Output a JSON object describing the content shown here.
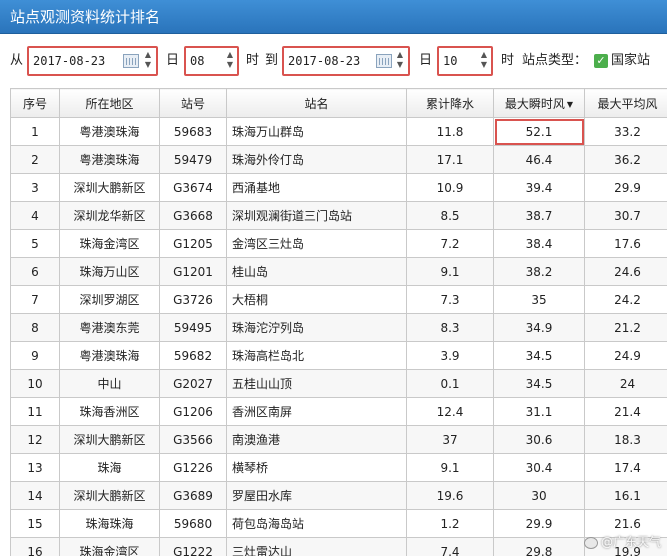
{
  "window": {
    "title": "站点观测资料统计排名"
  },
  "filters": {
    "from_label": "从",
    "start_date": "2017-08-23",
    "day_label_1": "日",
    "start_hour": "08",
    "hour_label_1": "时",
    "to_label": "到",
    "end_date": "2017-08-23",
    "day_label_2": "日",
    "end_hour": "10",
    "hour_label_2": "时",
    "station_type_label": "站点类型：",
    "station_type_option": "国家站"
  },
  "table": {
    "columns": [
      "序号",
      "所在地区",
      "站号",
      "站名",
      "累计降水",
      "最大瞬时风",
      "最大平均风"
    ],
    "sorted_column_index": 5,
    "highlight": {
      "row": 0,
      "col": 5
    },
    "rows": [
      [
        "1",
        "粤港澳珠海",
        "59683",
        "珠海万山群岛",
        "11.8",
        "52.1",
        "33.2"
      ],
      [
        "2",
        "粤港澳珠海",
        "59479",
        "珠海外伶仃岛",
        "17.1",
        "46.4",
        "36.2"
      ],
      [
        "3",
        "深圳大鹏新区",
        "G3674",
        "西涌基地",
        "10.9",
        "39.4",
        "29.9"
      ],
      [
        "4",
        "深圳龙华新区",
        "G3668",
        "深圳观澜街道三门岛站",
        "8.5",
        "38.7",
        "30.7"
      ],
      [
        "5",
        "珠海金湾区",
        "G1205",
        "金湾区三灶岛",
        "7.2",
        "38.4",
        "17.6"
      ],
      [
        "6",
        "珠海万山区",
        "G1201",
        "桂山岛",
        "9.1",
        "38.2",
        "24.6"
      ],
      [
        "7",
        "深圳罗湖区",
        "G3726",
        "大梧桐",
        "7.3",
        "35",
        "24.2"
      ],
      [
        "8",
        "粤港澳东莞",
        "59495",
        "珠海沱泞列岛",
        "8.3",
        "34.9",
        "21.2"
      ],
      [
        "9",
        "粤港澳珠海",
        "59682",
        "珠海高栏岛北",
        "3.9",
        "34.5",
        "24.9"
      ],
      [
        "10",
        "中山",
        "G2027",
        "五桂山山顶",
        "0.1",
        "34.5",
        "24"
      ],
      [
        "11",
        "珠海香洲区",
        "G1206",
        "香洲区南屏",
        "12.4",
        "31.1",
        "21.4"
      ],
      [
        "12",
        "深圳大鹏新区",
        "G3566",
        "南澳渔港",
        "37",
        "30.6",
        "18.3"
      ],
      [
        "13",
        "珠海",
        "G1226",
        "横琴桥",
        "9.1",
        "30.4",
        "17.4"
      ],
      [
        "14",
        "深圳大鹏新区",
        "G3689",
        "罗屋田水库",
        "19.6",
        "30",
        "16.1"
      ],
      [
        "15",
        "珠海珠海",
        "59680",
        "荷包岛海岛站",
        "1.2",
        "29.9",
        "21.6"
      ],
      [
        "16",
        "珠海金湾区",
        "G1222",
        "三灶雷达山",
        "7.4",
        "29.8",
        "19.9"
      ]
    ]
  },
  "watermark": {
    "text": "@广东天气"
  },
  "colors": {
    "titlebar": "#2f7fc6",
    "highlight_border": "#d9534f",
    "check": "#4cae4c"
  }
}
